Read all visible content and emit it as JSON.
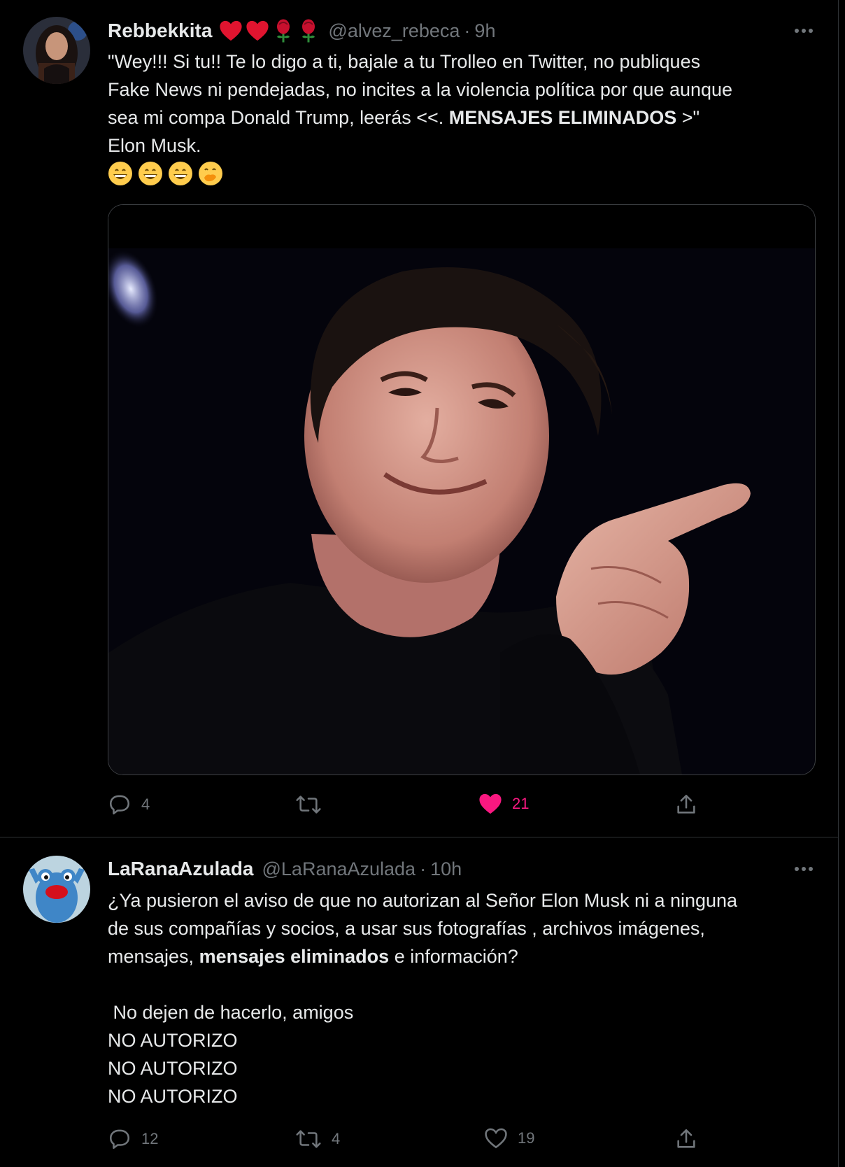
{
  "tweets": [
    {
      "author": "Rebbekkita",
      "name_emojis": [
        "heart",
        "heart",
        "rose",
        "rose"
      ],
      "handle": "@alvez_rebeca",
      "separator": "·",
      "time": "9h",
      "text_lines": [
        [
          "\"Wey!!!  Si tu!! Te lo digo a ti, bajale a tu Trolleo en Twitter, no publiques"
        ],
        [
          "Fake News ni pendejadas, no incites a la violencia política por que aunque"
        ],
        [
          "sea mi compa Donald Trump, leerás <<. ",
          "MENSAJES ELIMINADOS",
          " >\""
        ],
        [
          "Elon Musk."
        ]
      ],
      "emojis": [
        "grinning-face",
        "grinning-face",
        "grinning-face",
        "face-with-hand-over-mouth"
      ],
      "media": "photo-man-smiling-pointing",
      "replies": "4",
      "retweets": "",
      "likes": "21",
      "liked": true
    },
    {
      "author": "LaRanaAzulada",
      "handle": "@LaRanaAzulada",
      "separator": "·",
      "time": "10h",
      "text_lines": [
        [
          "¿Ya pusieron el aviso de que no autorizan al Señor Elon Musk ni a ninguna"
        ],
        [
          "de sus compañías y socios, a usar sus fotografías , archivos imágenes,"
        ],
        [
          "mensajes, ",
          "mensajes eliminados",
          " e información?"
        ],
        [
          ""
        ],
        [
          " No dejen de hacerlo, amigos"
        ],
        [
          "NO AUTORIZO"
        ],
        [
          "NO AUTORIZO"
        ],
        [
          "NO AUTORIZO"
        ]
      ],
      "replies": "12",
      "retweets": "4",
      "likes": "19",
      "liked": false
    }
  ],
  "colors": {
    "background": "#000000",
    "text": "#e7e9ea",
    "muted": "#71767b",
    "like": "#f91880",
    "divider": "#2f3336"
  }
}
